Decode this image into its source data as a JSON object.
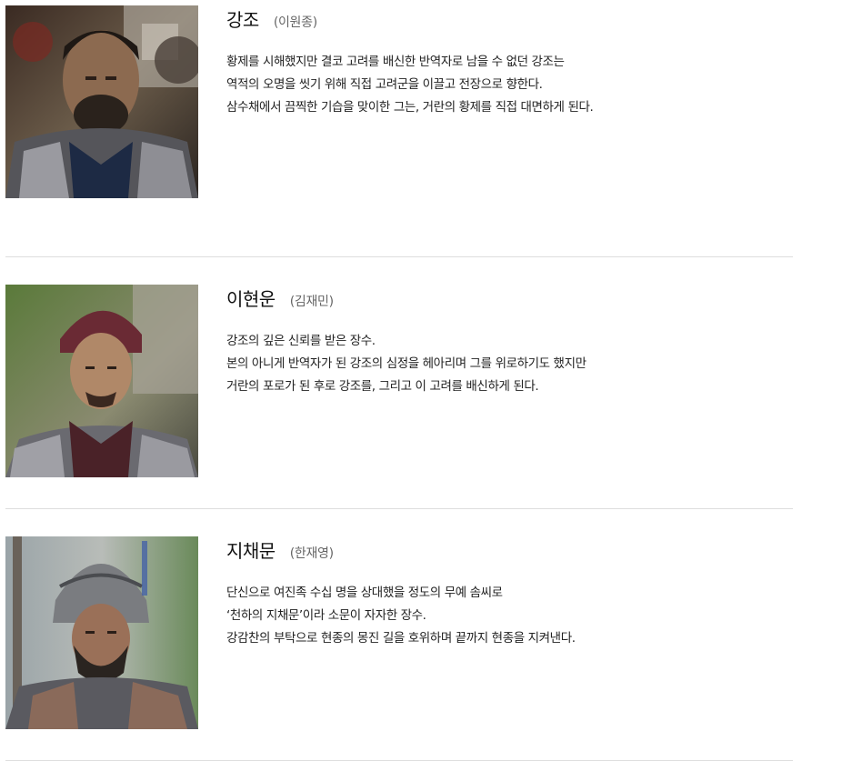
{
  "cast": [
    {
      "character": "강조",
      "actor": "(이원종)",
      "lines": [
        "황제를 시해했지만 결코 고려를 배신한 반역자로 남을 수 없던 강조는",
        "역적의 오명을 씻기 위해 직접 고려군을 이끌고 전장으로 향한다.",
        "삼수채에서 끔찍한 기습을 맞이한 그는, 거란의 황제를 직접 대면하게 된다."
      ]
    },
    {
      "character": "이현운",
      "actor": "(김재민)",
      "lines": [
        "강조의 깊은 신뢰를 받은 장수.",
        "본의 아니게 반역자가 된 강조의 심정을 헤아리며 그를 위로하기도 했지만",
        "거란의 포로가 된 후로 강조를, 그리고 이 고려를 배신하게 된다."
      ]
    },
    {
      "character": "지채문",
      "actor": "(한재영)",
      "lines": [
        "단신으로 여진족 수십 명을 상대했을 정도의 무예 솜씨로",
        "‘천하의 지채문’이라 소문이 자자한 장수.",
        "강감찬의 부탁으로 현종의 몽진 길을 호위하며 끝까지 현종을 지켜낸다."
      ]
    }
  ]
}
